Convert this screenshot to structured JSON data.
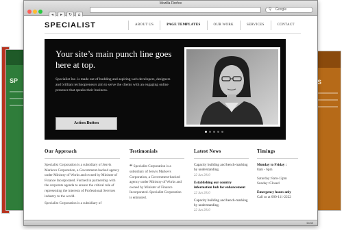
{
  "browser": {
    "window_title": "Mozilla Firefox",
    "search_value": "Google",
    "colors": {
      "close": "#ff5f57",
      "minimize": "#febc2e",
      "zoom": "#28c840"
    },
    "status_text": "Done"
  },
  "background_windows": {
    "left_caption": "SP",
    "right_caption": "S"
  },
  "site": {
    "logo": "SPECIALIST",
    "nav": [
      "ABOUT US",
      "PAGE TEMPLATES",
      "OUR WORK",
      "SERVICES",
      "CONTACT"
    ],
    "hero": {
      "punch_line": "Your site’s main punch line goes here at top.",
      "description": "Specialist Inc. is made out of budding and aspiring web developers, designers and brilliant technopreneurs aim to serve the clients with an engaging online presence that speaks their business.",
      "action_button": "Action Button",
      "slides": 5,
      "active_slide": 1
    },
    "approach": {
      "heading": "Our Approach",
      "p1": "Specialist Corporation is a subsidiary of Jenvis Markevs Corporation, a Government-backed agency under Ministry of Works and owned by Minister of Finance Incorporated. Formed in partnership with the corporate agenda to ensure the critical role of representing the interests of Professional Services industry to the world.",
      "p2": "Specialist Corporation is a subsidiary of"
    },
    "testimonials": {
      "heading": "Testimonials",
      "quote": "Specialist Corporation is a subsidiary of Jenvis Markevs Corporation, a Government-backed agency under Ministry of Works and owned by Minister of Finance Incorporated. Specialist Corporation is entrusted."
    },
    "news": {
      "heading": "Latest News",
      "items": [
        {
          "title": "Capacity building and bench-marking by understanding.",
          "date": "22 Jun 2010",
          "bold": false
        },
        {
          "title": "Establishing our country information hub for enhancement",
          "date": "22 Jun 2010",
          "bold": true
        },
        {
          "title": "Capacity building and bench-marking by understanding.",
          "date": "22 Jun 2010",
          "bold": false
        }
      ]
    },
    "timings": {
      "heading": "Timings",
      "rows": [
        {
          "label": "Monday to Friday :",
          "value": "8am - 6pm"
        },
        {
          "label": "Saturday: 8am-12pm",
          "value": "Sunday: Closed"
        },
        {
          "label": "Emergency hours only",
          "value": "Call us at 000-111-2222"
        }
      ]
    }
  }
}
